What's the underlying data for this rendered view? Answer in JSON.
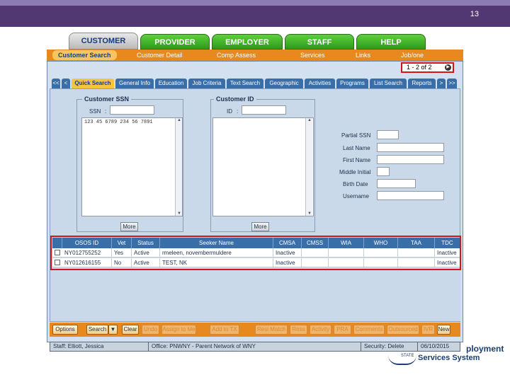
{
  "slide": {
    "number": "13"
  },
  "main_tabs": [
    "CUSTOMER",
    "PROVIDER",
    "EMPLOYER",
    "STAFF",
    "HELP"
  ],
  "sub_nav": [
    "Customer Search",
    "Customer Detail",
    "Comp Assess",
    "Services",
    "Links",
    "Job/one"
  ],
  "pager": {
    "text": "1 - 2 of 2"
  },
  "inner_tabs": [
    "<<",
    "<",
    "Quick Search",
    "General Info",
    "Education",
    "Job Criteria",
    "Text Search",
    "Geographic",
    "Activities",
    "Programs",
    "List Search",
    "Reports",
    ">",
    ">>"
  ],
  "customer_ssn": {
    "legend": "Customer SSN",
    "ssn_label": "SSN",
    "list_text": "123 45 6789 234 56 7891",
    "more_label": "More"
  },
  "customer_id": {
    "legend": "Customer ID",
    "id_label": "ID",
    "more_label": "More"
  },
  "search_fields": {
    "partial_ssn": "Partial SSN",
    "last_name": "Last Name",
    "first_name": "First Name",
    "middle_initial": "Middle Initial",
    "birth_date": "Birth Date",
    "username": "Username"
  },
  "grid": {
    "headers": [
      "OSOS ID",
      "Vet",
      "Status",
      "Seeker Name",
      "CMSA",
      "CMSS",
      "WIA",
      "WHO",
      "TAA",
      "TDC"
    ],
    "rows": [
      [
        "NY012755252",
        "Yes",
        "Active",
        "rmeleen, novembermuldere",
        "Inactive",
        "",
        "",
        "",
        "",
        "Inactive"
      ],
      [
        "NY012616155",
        "No",
        "Active",
        "TEST, NK",
        "Inactive",
        "",
        "",
        "",
        "",
        "Inactive"
      ]
    ]
  },
  "bottom_buttons": [
    "Options",
    "Search",
    "Clear",
    "Undo",
    "Assign to Me",
    "Add to TX",
    "Resi Match",
    "Ress",
    "Activity",
    "PRA",
    "Comments",
    "Outsourced",
    "IVR",
    "New"
  ],
  "status_bar": {
    "staff": "Staff: Elliott, Jessica",
    "office": "Office: PNWNY - Parent Network of WNY",
    "security": "Security: Delete",
    "date": "06/10/2015"
  },
  "logo": {
    "line1": "ployment",
    "line2": "Services System",
    "state": "STATE"
  },
  "colors": {
    "header": "#523873",
    "tab_green": "#2c9a1a",
    "subnav_orange": "#e8891f",
    "highlight_red": "#d4141b",
    "grid_blue": "#3a6ea8"
  }
}
